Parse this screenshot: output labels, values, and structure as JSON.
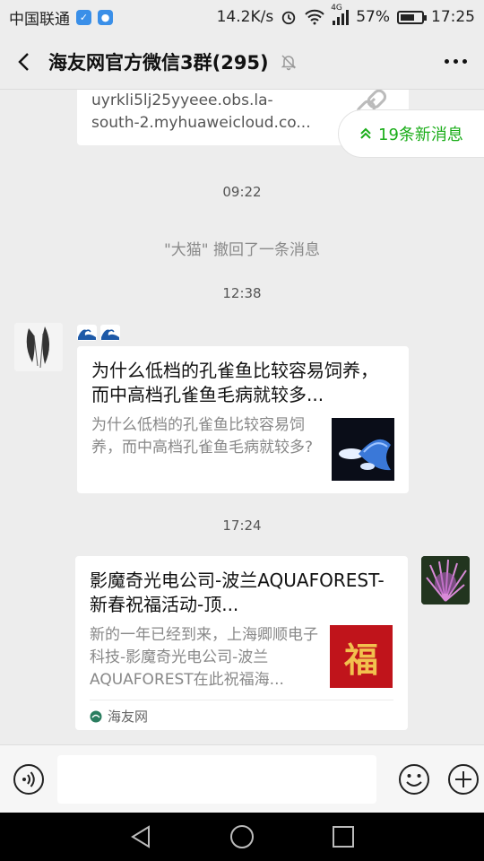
{
  "status_bar": {
    "carrier": "中国联通",
    "net_speed": "14.2K/s",
    "network_type": "4G",
    "battery": "57%",
    "time": "17:25"
  },
  "header": {
    "title": "海友网官方微信3群(295)"
  },
  "new_messages": {
    "label": "19条新消息"
  },
  "messages": {
    "link_card": {
      "text_line1": "uyrkli5lj25yyeee.obs.la-",
      "text_line2": "south-2.myhuaweicloud.co..."
    },
    "ts1": "09:22",
    "recall": "\"大猫\" 撤回了一条消息",
    "ts2": "12:38",
    "article1": {
      "title": "为什么低档的孔雀鱼比较容易饲养，而中高档孔雀鱼毛病就较多...",
      "desc": "为什么低档的孔雀鱼比较容易饲养，而中高档孔雀鱼毛病就较多?"
    },
    "ts3": "17:24",
    "article2": {
      "title": "影魔奇光电公司-波兰AQUAFOREST-新春祝福活动-顶...",
      "desc": "新的一年已经到来，上海卿顺电子科技-影魔奇光电公司-波兰AQUAFOREST在此祝福海...",
      "source": "海友网",
      "thumb_char": "福"
    }
  },
  "colors": {
    "accent_green": "#1aad19",
    "background": "#ededed"
  }
}
